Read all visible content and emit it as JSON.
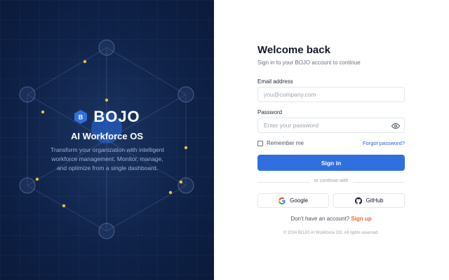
{
  "brand": {
    "logo_letter": "B",
    "name": "BOJO",
    "tagline": "AI Workforce OS",
    "description": "Transform your organization with intelligent workforce management. Monitor, manage, and optimize from a single dashboard."
  },
  "form": {
    "title": "Welcome back",
    "subtitle": "Sign in to your BOJO account to continue",
    "email_label": "Email address",
    "email_placeholder": "you@company.com",
    "password_label": "Password",
    "password_placeholder": "Enter your password",
    "remember_label": "Remember me",
    "forgot_label": "Forgot password?",
    "signin_label": "Sign in",
    "divider_text": "or continue with",
    "google_label": "Google",
    "github_label": "GitHub",
    "signup_prompt": "Don't have an account?",
    "signup_link": "Sign up",
    "copyright": "© 2024 BOJO AI Workforce OS. All rights reserved."
  },
  "colors": {
    "panel_bg": "#0f2249",
    "primary": "#2f6fe0",
    "node_dot": "#e8c13a",
    "link_accent": "#2563eb",
    "signup_accent": "#f0643c"
  }
}
